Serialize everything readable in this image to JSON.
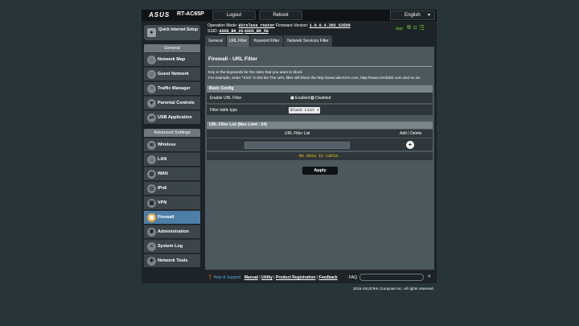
{
  "header": {
    "brand": "ASUS",
    "model": "RT-AC65P",
    "logout": "Logout",
    "reboot": "Reboot",
    "language": "English"
  },
  "info": {
    "op_mode_label": "Operation Mode:",
    "op_mode_value": "Wireless router",
    "fw_label": "Firmware Version:",
    "fw_value": "1.0.0.4.382_53599",
    "ssid_label": "SSID:",
    "ssid_1": "ASUS_B8_2G",
    "ssid_2": "ASUS_B8_5G",
    "app": "App"
  },
  "sidebar": {
    "quick_setup": "Quick Internet Setup",
    "general_head": "General",
    "general": [
      "Network Map",
      "Guest Network",
      "Traffic Manager",
      "Parental Controls",
      "USB Application"
    ],
    "advanced_head": "Advanced Settings",
    "advanced": [
      "Wireless",
      "LAN",
      "WAN",
      "IPv6",
      "VPN",
      "Firewall",
      "Administration",
      "System Log",
      "Network Tools"
    ]
  },
  "tabs": [
    "General",
    "URL Filter",
    "Keyword Filter",
    "Network Services Filter"
  ],
  "main": {
    "title": "Firewall - URL Filter",
    "desc1": "Key in the keywords for the sites that you want to block",
    "desc2": "For example, enter \"XXX\" in the list The URL filter will block the http://www.abcXXX.com, http://www.XXXbbb.com and so on.",
    "basic_config": "Basic Config",
    "enable_label": "Enable URL Filter",
    "enabled": "Enabled",
    "disabled": "Disabled",
    "filter_type_label": "Filter table type",
    "filter_type_value": "Black List",
    "list_head": "URL Filter List (Max Limit : 64)",
    "col_url": "URL Filter List",
    "col_add": "Add / Delete",
    "no_data": "No data in table.",
    "apply": "Apply"
  },
  "footer": {
    "help": "Help & Support",
    "manual": "Manual",
    "utility": "Utility",
    "product_reg": "Product Registration",
    "feedback": "Feedback",
    "faq": "FAQ",
    "copyright": "2019 ASUSTeK Computer Inc. All rights reserved."
  },
  "colors": {
    "active_nav": "#4d7ea8",
    "no_data": "#f2c811",
    "status_green": "#6fcf2c"
  }
}
